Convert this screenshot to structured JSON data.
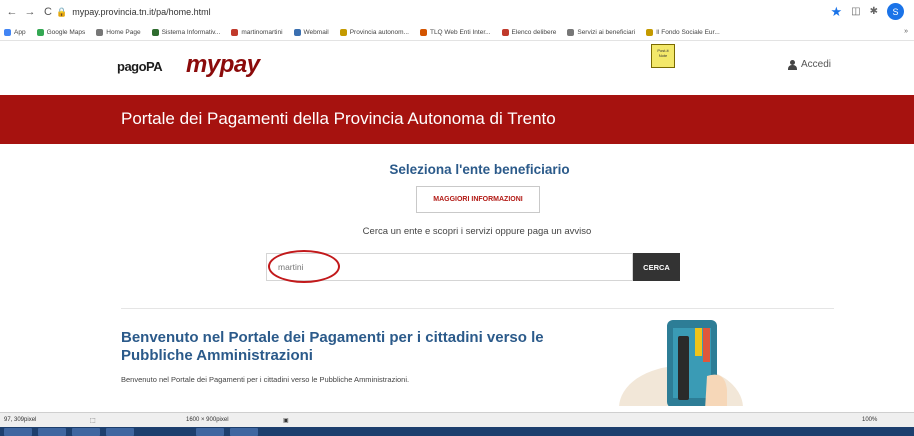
{
  "browser": {
    "url": "mypay.provincia.tn.it/pa/home.html",
    "back_glyph": "←",
    "forward_glyph": "→",
    "reload_glyph": "C",
    "lock_glyph": "🔒",
    "star_glyph": "★",
    "profile_initial": "S",
    "bookmarks": [
      {
        "label": "App",
        "color": "#4285f4"
      },
      {
        "label": "Google Maps",
        "color": "#34a853"
      },
      {
        "label": "Home Page",
        "color": "#777777"
      },
      {
        "label": "Sistema Informativ...",
        "color": "#2e6b2e"
      },
      {
        "label": "martinomartini",
        "color": "#c0392b"
      },
      {
        "label": "Webmail",
        "color": "#3a6fb0"
      },
      {
        "label": "Provincia autonom...",
        "color": "#c49a00"
      },
      {
        "label": "TLQ Web Enti Inter...",
        "color": "#d35400"
      },
      {
        "label": "Elenco delibere",
        "color": "#c0392b"
      },
      {
        "label": "Servizi ai beneficiari",
        "color": "#777777"
      },
      {
        "label": "Il Fondo Sociale Eur...",
        "color": "#c49a00"
      }
    ],
    "bookmarks_more": "»"
  },
  "header": {
    "logo_pagopa": "pagoPA",
    "logo_mypay": "mypay",
    "sticky_note": "Post-it Note",
    "login_label": "Accedi"
  },
  "banner": {
    "title": "Portale dei Pagamenti della Provincia Autonoma di Trento"
  },
  "main": {
    "select_title": "Seleziona l'ente beneficiario",
    "info_button": "MAGGIORI INFORMAZIONI",
    "search_hint": "Cerca un ente e scopri i servizi oppure paga un avviso",
    "search_value": "martini",
    "search_button": "CERCA"
  },
  "welcome": {
    "title": "Benvenuto nel Portale dei Pagamenti per i cittadini verso le Pubbliche Amministrazioni",
    "text": "Benvenuto nel Portale dei Pagamenti per i cittadini verso le Pubbliche Amministrazioni."
  },
  "statusbar": {
    "coords": "97, 309pixel",
    "dims": "1600 × 900pixel",
    "zoom": "100%"
  },
  "colors": {
    "brand_red": "#a6120f",
    "title_blue": "#2b5a8a",
    "search_button_bg": "#333333"
  }
}
